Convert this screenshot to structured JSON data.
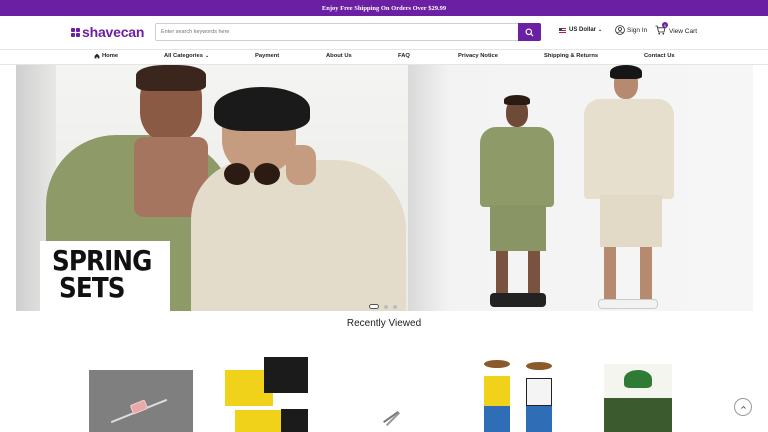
{
  "announcement": "Enjoy Free Shipping On Orders Over $29.99",
  "brand": {
    "name": "shavecan",
    "color": "#6b1fa3"
  },
  "search": {
    "placeholder": "Enter search keywords here",
    "icon": "search-icon"
  },
  "header": {
    "currency": "US Dollar",
    "signin": "Sign In",
    "cart": "View Cart",
    "cart_count": "0"
  },
  "nav": {
    "home": "Home",
    "categories": "All Categories",
    "payment": "Payment",
    "about": "About Us",
    "faq": "FAQ",
    "privacy": "Privacy Notice",
    "shipping": "Shipping & Returns",
    "contact": "Contact Us"
  },
  "hero": {
    "badge_line1": "SPRING",
    "badge_line2": "SETS",
    "slides": 3,
    "active_slide": 1
  },
  "recently_viewed": {
    "title": "Recently Viewed",
    "items": [
      {
        "name": "product-fuel-filter"
      },
      {
        "name": "product-libretto-cloths"
      },
      {
        "name": "product-metal-pins"
      },
      {
        "name": "product-cowboy-costumes"
      },
      {
        "name": "product-seed-pack"
      }
    ]
  }
}
